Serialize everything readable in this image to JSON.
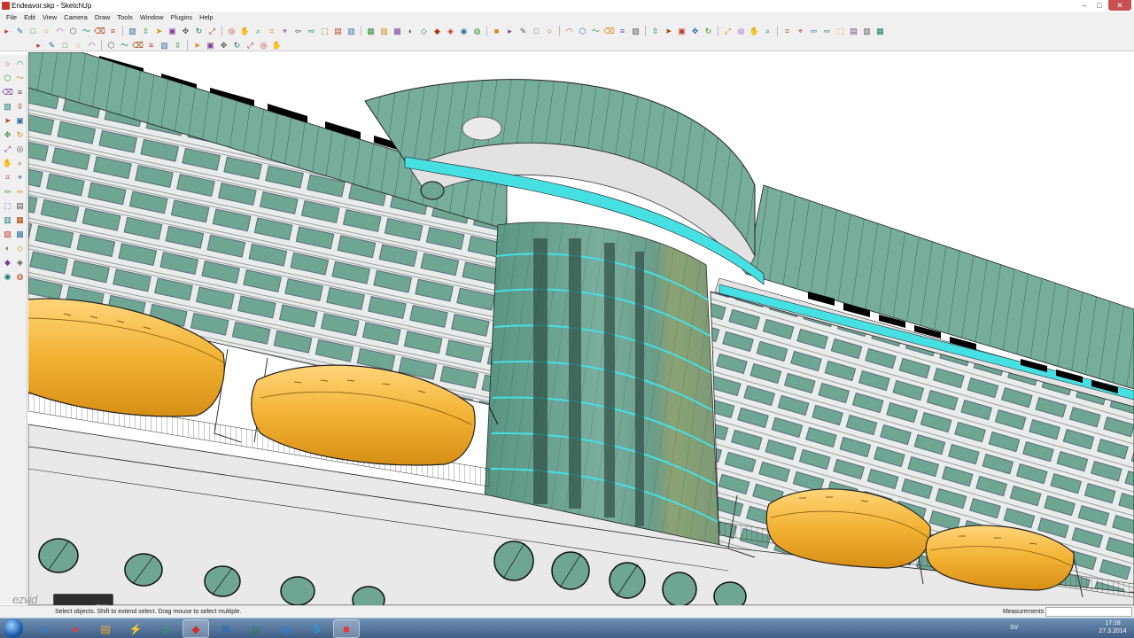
{
  "window": {
    "title": "Endeavor.skp - SketchUp",
    "minimize": "–",
    "maximize": "□",
    "close": "✕"
  },
  "menu": [
    "File",
    "Edit",
    "View",
    "Camera",
    "Draw",
    "Tools",
    "Window",
    "Plugins",
    "Help"
  ],
  "toolbar": {
    "row1": [
      "select-icon",
      "pencil-icon",
      "rectangle-icon",
      "circle-icon",
      "arc-icon",
      "polygon-icon",
      "freehand-icon",
      "eraser-icon",
      "tape-icon",
      "paint-bucket-icon",
      "push-pull-icon",
      "follow-me-icon",
      "offset-icon",
      "move-icon",
      "rotate-icon",
      "scale-icon",
      "orbit-icon",
      "pan-icon",
      "zoom-icon",
      "zoom-window-icon",
      "zoom-extents-icon",
      "previous-view-icon",
      "next-view-icon",
      "iso-view-icon",
      "top-view-icon",
      "front-view-icon",
      "right-view-icon",
      "back-view-icon",
      "left-view-icon",
      "xray-icon",
      "wireframe-icon",
      "hidden-line-icon",
      "shaded-icon",
      "textured-icon",
      "monochrome-icon",
      "cube-icon",
      "section-plane-icon",
      "section-display-icon",
      "layer-icon",
      "sandbox-icon",
      "dimension-icon",
      "text-icon",
      "axes-icon",
      "3d-text-icon",
      "walk-icon",
      "look-around-icon",
      "position-camera-icon",
      "shadow-icon",
      "fog-icon",
      "match-photo-icon",
      "warehouse-icon",
      "share-model-icon",
      "component-icon",
      "google-earth-icon",
      "terrain-icon",
      "photo-texture-icon",
      "render-icon",
      "lamp-icon",
      "sphere-icon",
      "cylinder-icon",
      "cone-icon",
      "torus-icon",
      "plugin-icon"
    ],
    "row2": [
      "stamp-icon",
      "drape-icon",
      "smoove-icon",
      "add-detail-icon",
      "flip-edge-icon",
      "solid-union-icon",
      "solid-subtract-icon",
      "solid-intersect-icon",
      "solid-trim-icon",
      "solid-split-icon",
      "outer-shell-icon",
      "undo-icon",
      "redo-icon",
      "cut-icon",
      "copy-icon",
      "paste-icon",
      "delete-icon",
      "print-icon"
    ]
  },
  "palette": [
    "select-icon",
    "make-component-icon",
    "paint-bucket-icon",
    "eraser-icon",
    "rectangle-icon",
    "line-icon",
    "circle-icon",
    "arc-icon",
    "polygon-icon",
    "freehand-icon",
    "move-icon",
    "push-pull-icon",
    "rotate-icon",
    "follow-me-icon",
    "scale-icon",
    "offset-icon",
    "tape-icon",
    "dimension-icon",
    "protractor-icon",
    "text-icon",
    "axes-icon",
    "3d-text-icon",
    "orbit-icon",
    "pan-icon",
    "zoom-icon",
    "zoom-window-icon",
    "previous-icon",
    "zoom-extents-icon",
    "position-camera-icon",
    "look-around-icon",
    "walk-icon",
    "section-plane-icon"
  ],
  "status": {
    "hint": "Select objects. Shift to extend select. Drag mouse to select multiple.",
    "measurements_label": "Measurements",
    "measurements_value": ""
  },
  "overlay": {
    "logo": "ezvid",
    "sub": "RECORDER",
    "draw": "DRAW"
  },
  "taskbar": {
    "apps": [
      "ie-icon",
      "chrome-icon",
      "explorer-icon",
      "flash-icon",
      "spotify-icon",
      "sketchup-icon",
      "thunderbird-icon",
      "utorrent-icon",
      "google-earth-icon",
      "skype-icon",
      "layout-icon"
    ],
    "tray_lang": "SV",
    "time": "17:18",
    "date": "27.3.2014"
  },
  "colors": {
    "glass": "#5f9e8b",
    "glass_light": "#9cc9bb",
    "accent_cyan": "#46e0e3",
    "lifeboat": "#f2b233",
    "hull": "#e9e9e9"
  }
}
